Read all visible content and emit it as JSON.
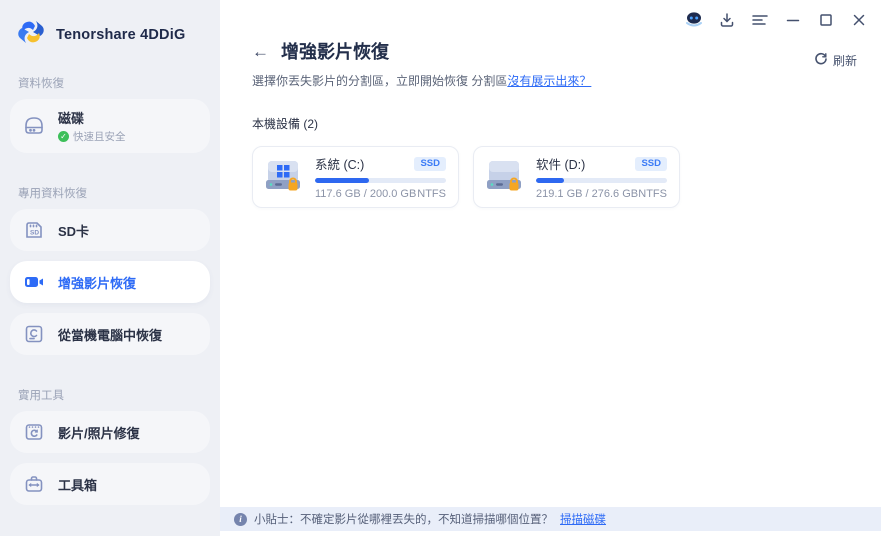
{
  "app": {
    "brand": "Tenorshare 4DDiG"
  },
  "titlebar": {
    "icons": [
      "assistant-bot-icon",
      "download-icon",
      "menu-icon",
      "minimize-icon",
      "maximize-icon",
      "close-icon"
    ]
  },
  "sidebar": {
    "sections": [
      {
        "label": "資料恢復",
        "items": [
          {
            "label": "磁碟",
            "badge": "快速且安全",
            "icon": "disk-icon",
            "active": false
          }
        ]
      },
      {
        "label": "專用資料恢復",
        "items": [
          {
            "label": "SD卡",
            "icon": "sd-card-icon",
            "active": false
          },
          {
            "label": "增強影片恢復",
            "icon": "video-camera-icon",
            "active": true
          },
          {
            "label": "從當機電腦中恢復",
            "icon": "crashed-computer-icon",
            "active": false
          }
        ]
      },
      {
        "label": "實用工具",
        "items": [
          {
            "label": "影片/照片修復",
            "icon": "media-repair-icon",
            "active": false
          },
          {
            "label": "工具箱",
            "icon": "toolbox-icon",
            "active": false
          }
        ]
      }
    ]
  },
  "main": {
    "back_arrow": "←",
    "title": "增強影片恢復",
    "subtitle": "選擇你丟失影片的分割區，立即開始恢復 分割區",
    "subtitle_link": "沒有展示出來？",
    "refresh_label": "刷新",
    "devices_label": "本機設備 (2)",
    "drives": [
      {
        "name": "系統 (C:)",
        "badge": "SSD",
        "capacity": "117.6 GB / 200.0 GB",
        "filesystem": "NTFS",
        "used_percent": 41,
        "icon": "windows-system-drive-icon"
      },
      {
        "name": "软件 (D:)",
        "badge": "SSD",
        "capacity": "219.1 GB / 276.6 GB",
        "filesystem": "NTFS",
        "used_percent": 21,
        "icon": "data-drive-icon"
      }
    ]
  },
  "footer": {
    "tip_text": "小貼士：不確定影片從哪裡丟失的，不知道掃描哪個位置？",
    "tip_link": "掃描磁碟"
  },
  "colors": {
    "accent": "#2E6BF6",
    "sidebar_bg": "#EEF0F5",
    "badge_bg": "#E4EEFD",
    "badge_text": "#3B7BF6",
    "progress_track": "#E3EAF7",
    "progress_fill": "#2E68F0",
    "footer_bg": "#E9EEF9",
    "success_green": "#3DBF5A",
    "lock_orange": "#F5A623"
  }
}
